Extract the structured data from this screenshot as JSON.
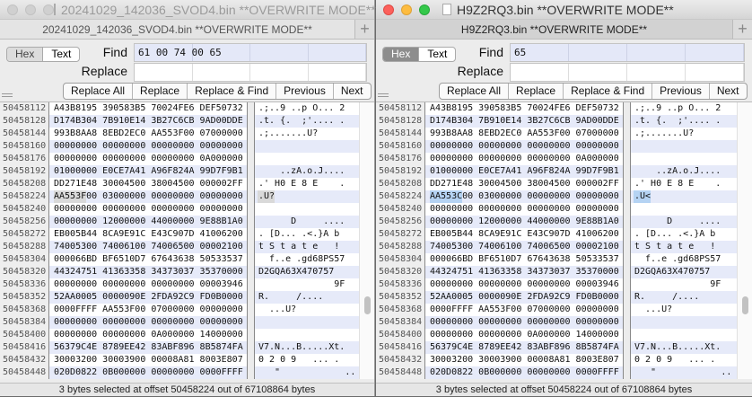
{
  "windows": [
    {
      "title": "20241029_142036_SVOD4.bin **OVERWRITE MODE**",
      "tab": "20241029_142036_SVOD4.bin **OVERWRITE MODE**",
      "active": false,
      "mode_hex": "Hex",
      "mode_text": "Text",
      "find_label": "Find",
      "find_value": "61 00 74 00 65",
      "replace_label": "Replace",
      "replace_value": "",
      "buttons": [
        "Replace All",
        "Replace",
        "Replace & Find",
        "Previous",
        "Next"
      ],
      "selection": {
        "row_offset": "50458224",
        "bytes": 3
      },
      "status": "3 bytes selected at offset 50458224 out of 67108864 bytes",
      "rows": [
        [
          "50458112",
          "A43B8195 390583B5 70024FE6 DEF50732",
          ".;..9 ..p O... 2"
        ],
        [
          "50458128",
          "D174B304 7B910E14 3B27C6CB 9AD00DDE",
          ".t. {.  ;'.... ."
        ],
        [
          "50458144",
          "993B8AA8 8EBD2EC0 AA553F00 07000000",
          ".;.......U?"
        ],
        [
          "50458160",
          "00000000 00000000 00000000 00000000",
          ""
        ],
        [
          "50458176",
          "00000000 00000000 00000000 0A000000",
          ""
        ],
        [
          "50458192",
          "01000000 E0CE7A41 A96F824A 99D7F9B1",
          "    ..zA.o.J...."
        ],
        [
          "50458208",
          "DD271E48 30004500 38004500 000002FF",
          ".' H0 E 8 E    ."
        ],
        [
          "50458224",
          "AA553F00 03000000 00000000 00000000",
          ".U?"
        ],
        [
          "50458240",
          "00000000 00000000 00000000 00000000",
          ""
        ],
        [
          "50458256",
          "00000000 12000000 44000000 9E88B1A0",
          "      D     ...."
        ],
        [
          "50458272",
          "EB005B44 8CA9E91C E43C907D 41006200",
          ". [D... .<.}A b"
        ],
        [
          "50458288",
          "74005300 74006100 74006500 00002100",
          "t S t a t e   !"
        ],
        [
          "50458304",
          "000066BD BF6510D7 67643638 50533537",
          "  f..e .gd68PS57"
        ],
        [
          "50458320",
          "44324751 41363358 34373037 35370000",
          "D2GQA63X470757"
        ],
        [
          "50458336",
          "00000000 00000000 00000000 00003946",
          "              9F"
        ],
        [
          "50458352",
          "52AA0005 0000090E 2FDA92C9 FD0B0000",
          "R.     /...."
        ],
        [
          "50458368",
          "0000FFFF AA553F00 07000000 00000000",
          "  ...U?"
        ],
        [
          "50458384",
          "00000000 00000000 00000000 00000000",
          ""
        ],
        [
          "50458400",
          "00000000 00000000 0A000000 14000000",
          ""
        ],
        [
          "50458416",
          "56379C4E 8789EE42 83ABF896 8B5874FA",
          "V7.N...B.....Xt."
        ],
        [
          "50458432",
          "30003200 30003900 00008A81 8003E807",
          "0 2 0 9   ... ."
        ],
        [
          "50458448",
          "020D0822 0B000000 00000000 0000FFFF",
          "   \"            .."
        ]
      ]
    },
    {
      "title": "H9Z2RQ3.bin **OVERWRITE MODE**",
      "tab": "H9Z2RQ3.bin **OVERWRITE MODE**",
      "active": true,
      "mode_hex": "Hex",
      "mode_text": "Text",
      "find_label": "Find",
      "find_value": "65",
      "replace_label": "Replace",
      "replace_value": "",
      "buttons": [
        "Replace All",
        "Replace",
        "Replace & Find",
        "Previous",
        "Next"
      ],
      "selection": {
        "row_offset": "50458224",
        "bytes": 3
      },
      "status": "3 bytes selected at offset 50458224 out of 67108864 bytes",
      "rows": [
        [
          "50458112",
          "A43B8195 390583B5 70024FE6 DEF50732",
          ".;..9 ..p O... 2"
        ],
        [
          "50458128",
          "D174B304 7B910E14 3B27C6CB 9AD00DDE",
          ".t. {.  ;'.... ."
        ],
        [
          "50458144",
          "993B8AA8 8EBD2EC0 AA553F00 07000000",
          ".;.......U?"
        ],
        [
          "50458160",
          "00000000 00000000 00000000 00000000",
          ""
        ],
        [
          "50458176",
          "00000000 00000000 00000000 0A000000",
          ""
        ],
        [
          "50458192",
          "01000000 E0CE7A41 A96F824A 99D7F9B1",
          "    ..zA.o.J...."
        ],
        [
          "50458208",
          "DD271E48 30004500 38004500 000002FF",
          ".' H0 E 8 E    ."
        ],
        [
          "50458224",
          "AA553C00 03000000 00000000 00000000",
          ".U<"
        ],
        [
          "50458240",
          "00000000 00000000 00000000 00000000",
          ""
        ],
        [
          "50458256",
          "00000000 12000000 44000000 9E88B1A0",
          "      D     ...."
        ],
        [
          "50458272",
          "EB005B44 8CA9E91C E43C907D 41006200",
          ". [D... .<.}A b"
        ],
        [
          "50458288",
          "74005300 74006100 74006500 00002100",
          "t S t a t e   !"
        ],
        [
          "50458304",
          "000066BD BF6510D7 67643638 50533537",
          "  f..e .gd68PS57"
        ],
        [
          "50458320",
          "44324751 41363358 34373037 35370000",
          "D2GQA63X470757"
        ],
        [
          "50458336",
          "00000000 00000000 00000000 00003946",
          "              9F"
        ],
        [
          "50458352",
          "52AA0005 0000090E 2FDA92C9 FD0B0000",
          "R.     /...."
        ],
        [
          "50458368",
          "0000FFFF AA553F00 07000000 00000000",
          "  ...U?"
        ],
        [
          "50458384",
          "00000000 00000000 00000000 00000000",
          ""
        ],
        [
          "50458400",
          "00000000 00000000 0A000000 14000000",
          ""
        ],
        [
          "50458416",
          "56379C4E 8789EE42 83ABF896 8B5874FA",
          "V7.N...B.....Xt."
        ],
        [
          "50458432",
          "30003200 30003900 00008A81 8003E807",
          "0 2 0 9   ... ."
        ],
        [
          "50458448",
          "020D0822 0B000000 00000000 0000FFFF",
          "   \"            .."
        ]
      ]
    }
  ]
}
